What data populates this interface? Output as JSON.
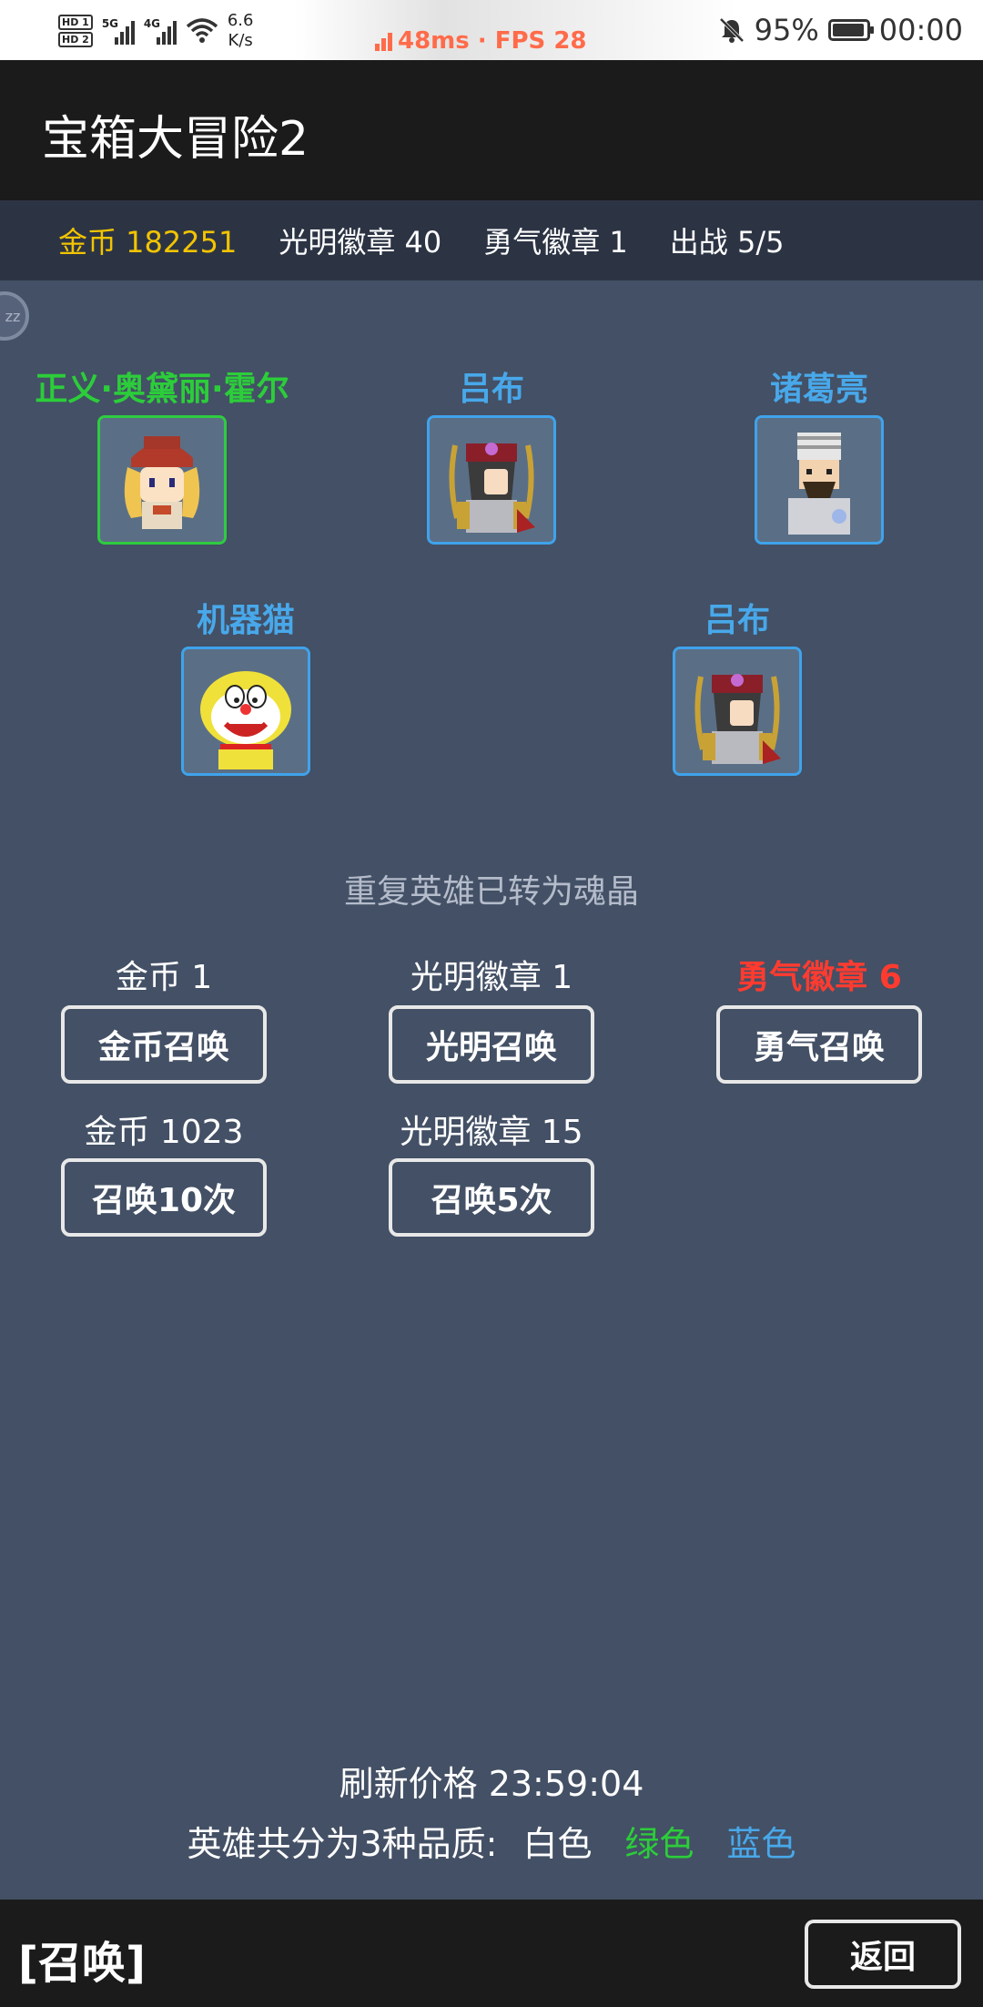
{
  "status_bar": {
    "hd1": "HD 1",
    "hd2": "HD 2",
    "net1": "5G",
    "net2": "4G",
    "speed_value": "6.6",
    "speed_unit": "K/s",
    "perf": "48ms · FPS 28",
    "battery": "95%",
    "time": "00:00",
    "icons": [
      "signal-icon",
      "wifi-icon",
      "mute-bell-icon",
      "battery-icon"
    ]
  },
  "app": {
    "title": "宝箱大冒险2"
  },
  "resources": {
    "gold": "金币 182251",
    "light_badge": "光明徽章 40",
    "courage_badge": "勇气徽章 1",
    "deploy": "出战 5/5"
  },
  "float_ball": {
    "label": "zz"
  },
  "heroes": [
    {
      "name": "正义·奥黛丽·霍尔",
      "quality": "green"
    },
    {
      "name": "吕布",
      "quality": "blue"
    },
    {
      "name": "诸葛亮",
      "quality": "blue"
    },
    {
      "name": "机器猫",
      "quality": "blue"
    },
    {
      "name": "吕布",
      "quality": "blue"
    }
  ],
  "notice": "重复英雄已转为魂晶",
  "summon": {
    "gold": {
      "cost": "金币 1",
      "button": "金币召唤"
    },
    "light": {
      "cost": "光明徽章 1",
      "button": "光明召唤"
    },
    "courage": {
      "cost": "勇气徽章 6",
      "button": "勇气召唤"
    },
    "gold10": {
      "cost": "金币 1023",
      "button": "召唤10次"
    },
    "light5": {
      "cost": "光明徽章 15",
      "button": "召唤5次"
    }
  },
  "refresh": "刷新价格 23:59:04",
  "quality_info": {
    "prefix": "英雄共分为3种品质:",
    "white": "白色",
    "green": "绿色",
    "blue": "蓝色"
  },
  "bottom": {
    "title": "[召唤]",
    "back": "返回"
  },
  "colors": {
    "background": "#435065",
    "bar": "#1b1b1b",
    "resource_bar": "#2c3444",
    "gold": "#f2c400",
    "green_quality": "#2ccd3a",
    "blue_quality": "#48a8ea",
    "warning": "#ff3b30"
  }
}
